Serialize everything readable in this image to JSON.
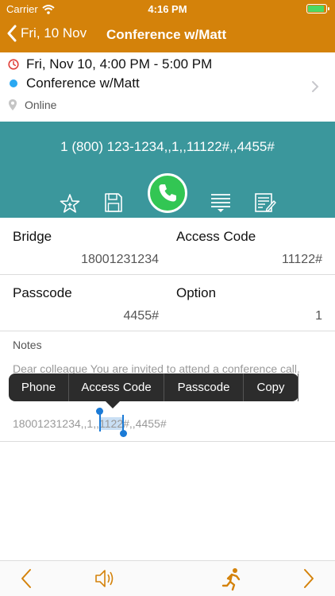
{
  "status": {
    "carrier": "Carrier",
    "time": "4:16 PM"
  },
  "nav": {
    "back_label": "Fri, 10 Nov",
    "title": "Conference w/Matt"
  },
  "event": {
    "datetime": "Fri, Nov 10, 4:00 PM - 5:00 PM",
    "title": "Conference w/Matt",
    "location": "Online"
  },
  "dial": {
    "string": "1 (800) 123-1234,,1,,11122#,,4455#"
  },
  "fields": {
    "bridge_label": "Bridge",
    "bridge_value": "18001231234",
    "access_label": "Access Code",
    "access_value": "11122#",
    "passcode_label": "Passcode",
    "passcode_value": "4455#",
    "option_label": "Option",
    "option_value": "1"
  },
  "notes": {
    "label": "Notes",
    "line1": "Dear colleague You are invited to attend a conference call.",
    "numbers_pre": "18001231234,,1,,",
    "numbers_sel": "1122",
    "numbers_post": "#,,4455#"
  },
  "edit_menu": {
    "phone": "Phone",
    "access_code": "Access Code",
    "passcode": "Passcode",
    "copy": "Copy"
  },
  "colors": {
    "accent": "#d4820a",
    "teal": "#3b979c",
    "call_green": "#32c653",
    "event_dot": "#2aa8f2",
    "selection": "#1a7ad6"
  },
  "icons": [
    "wifi-icon",
    "back-chevron-icon",
    "clock-icon",
    "location-pin-icon",
    "chevron-right-icon",
    "star-icon",
    "save-icon",
    "phone-icon",
    "list-icon",
    "note-icon",
    "previous-icon",
    "speaker-icon",
    "running-icon",
    "next-icon"
  ]
}
